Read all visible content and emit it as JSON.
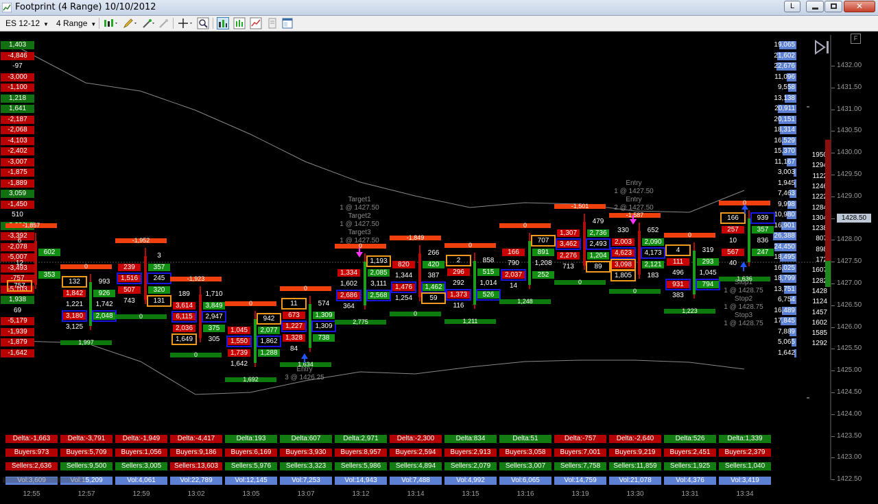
{
  "window": {
    "title": "Footprint (4 Range)  10/10/2012",
    "l_button": "L"
  },
  "toolbar": {
    "instrument": "ES 12-12",
    "period": "4 Range"
  },
  "colors": {
    "sell": "#c80000",
    "buy": "#138f13",
    "imbalance_blue": "#1818e0",
    "imbalance_orange": "#f19a1c",
    "volume": "#5b80d4",
    "delta_neg": "#f0400e",
    "delta_pos": "#0c7a0c"
  },
  "price_axis": {
    "labels": [
      "1432.00",
      "1431.50",
      "1431.00",
      "1430.50",
      "1430.00",
      "1429.50",
      "1429.00",
      "1428.50",
      "1428.00",
      "1427.50",
      "1427.00",
      "1426.50",
      "1426.00",
      "1425.50",
      "1425.00",
      "1424.50",
      "1424.00",
      "1423.50",
      "1423.00",
      "1422.50"
    ],
    "current_price": "1428.50"
  },
  "left_delta": [
    [
      "1,403",
      "g"
    ],
    [
      "-4,846",
      "r"
    ],
    [
      "-97",
      "k"
    ],
    [
      "-3,000",
      "r"
    ],
    [
      "-1,100",
      "r"
    ],
    [
      "1,218",
      "g"
    ],
    [
      "1,641",
      "g"
    ],
    [
      "-2,187",
      "r"
    ],
    [
      "-2,068",
      "r"
    ],
    [
      "-4,103",
      "r"
    ],
    [
      "-2,402",
      "r"
    ],
    [
      "-3,007",
      "r"
    ],
    [
      "-1,875",
      "r"
    ],
    [
      "-1,889",
      "r"
    ],
    [
      "3,059",
      "g"
    ],
    [
      "-1,450",
      "r"
    ],
    [
      "510",
      "k"
    ],
    [
      "2,281",
      "g"
    ],
    [
      "-3,392",
      "r"
    ],
    [
      "-2,078",
      "r"
    ],
    [
      "-5,007",
      "r"
    ],
    [
      "-3,493",
      "r"
    ],
    [
      "-757",
      "r"
    ],
    [
      "-5,103",
      "r"
    ],
    [
      "1,938",
      "g"
    ],
    [
      "69",
      "k"
    ],
    [
      "-5,179",
      "r"
    ],
    [
      "-1,939",
      "r"
    ],
    [
      "-1,879",
      "r"
    ],
    [
      "-1,642",
      "r"
    ]
  ],
  "volume_profile": [
    "19,065",
    "21,602",
    "22,676",
    "11,096",
    "9,558",
    "13,138",
    "20,911",
    "20,151",
    "18,314",
    "16,529",
    "15,370",
    "11,167",
    "3,003",
    "1,945",
    "7,463",
    "9,998",
    "10,980",
    "16,901",
    "26,388",
    "24,450",
    "18,495",
    "16,025",
    "18,799",
    "13,751",
    "6,754",
    "16,489",
    "17,845",
    "7,889",
    "5,065",
    "1,642"
  ],
  "pending_volumes": [
    "1950",
    "1294",
    "1122",
    "1246",
    "1222",
    "1284",
    "1304",
    "1238",
    "807",
    "898",
    "172",
    "1607",
    "1282",
    "1428",
    "1124",
    "1457",
    "1602",
    "1585",
    "1292"
  ],
  "bars": [
    {
      "time": "12:55",
      "delta": "Delta:-1,663",
      "buyers": "Buyers:973",
      "sellers": "Sellers:2,636",
      "vol": "Vol:3,609",
      "top": "-1,857",
      "bottom": "",
      "cells": [
        [
          "6",
          "",
          "",
          ""
        ],
        [
          "",
          "602",
          "",
          ""
        ],
        [
          "12",
          "",
          "",
          ""
        ],
        [
          "",
          "353",
          "",
          ""
        ],
        [
          "757",
          "",
          "o",
          ""
        ]
      ]
    },
    {
      "time": "12:57",
      "delta": "Delta:-3,791",
      "buyers": "Buyers:5,709",
      "sellers": "Sellers:9,500",
      "vol": "Vol:15,209",
      "top": "0",
      "bottom": "1,997",
      "cells": [
        [
          "132",
          "993",
          "o",
          ""
        ],
        [
          "1,842",
          "926",
          "",
          ""
        ],
        [
          "1,221",
          "1,742",
          "",
          ""
        ],
        [
          "3,180",
          "2,048",
          "b",
          "b"
        ],
        [
          "3,125",
          "",
          "",
          ""
        ]
      ]
    },
    {
      "time": "12:59",
      "delta": "Delta:-1,949",
      "buyers": "Buyers:1,056",
      "sellers": "Sellers:3,005",
      "vol": "Vol:4,061",
      "top": "-1,952",
      "bottom": "0",
      "cells": [
        [
          "",
          "3",
          "",
          ""
        ],
        [
          "239",
          "357",
          "",
          ""
        ],
        [
          "1,516",
          "245",
          "b",
          "b"
        ],
        [
          "507",
          "320",
          "",
          ""
        ],
        [
          "743",
          "131",
          "",
          "o"
        ]
      ]
    },
    {
      "time": "13:02",
      "delta": "Delta:-4,417",
      "buyers": "Buyers:9,186",
      "sellers": "Sellers:13,603",
      "vol": "Vol:22,789",
      "top": "-1,923",
      "bottom": "0",
      "cells": [
        [
          "189",
          "1,710",
          "",
          ""
        ],
        [
          "3,614",
          "3,849",
          "",
          ""
        ],
        [
          "6,115",
          "2,947",
          "b",
          "b"
        ],
        [
          "2,036",
          "375",
          "",
          ""
        ],
        [
          "1,649",
          "305",
          "o",
          ""
        ]
      ]
    },
    {
      "time": "13:05",
      "delta": "Delta:193",
      "buyers": "Buyers:6,169",
      "sellers": "Sellers:5,976",
      "vol": "Vol:12,145",
      "top": "0",
      "bottom": "1,692",
      "cells": [
        [
          "",
          "942",
          "",
          "o"
        ],
        [
          "1,045",
          "2,077",
          "",
          ""
        ],
        [
          "1,550",
          "1,862",
          "b",
          "b"
        ],
        [
          "1,739",
          "1,288",
          "",
          ""
        ],
        [
          "1,642",
          "",
          "",
          ""
        ]
      ]
    },
    {
      "time": "13:07",
      "delta": "Delta:607",
      "buyers": "Buyers:3,930",
      "sellers": "Sellers:3,323",
      "vol": "Vol:7,253",
      "top": "0",
      "bottom": "1,634",
      "cells": [
        [
          "11",
          "574",
          "o",
          ""
        ],
        [
          "673",
          "1,309",
          "",
          ""
        ],
        [
          "1,227",
          "1,309",
          "b",
          "b"
        ],
        [
          "1,328",
          "738",
          "",
          ""
        ],
        [
          "84",
          "",
          "",
          ""
        ]
      ]
    },
    {
      "time": "13:12",
      "delta": "Delta:2,971",
      "buyers": "Buyers:8,957",
      "sellers": "Sellers:5,986",
      "vol": "Vol:14,943",
      "top": "0",
      "bottom": "2,775",
      "cells": [
        [
          "",
          "1,193",
          "",
          "o"
        ],
        [
          "1,334",
          "2,085",
          "",
          ""
        ],
        [
          "1,602",
          "3,111",
          "",
          ""
        ],
        [
          "2,686",
          "2,568",
          "b",
          "b"
        ],
        [
          "364",
          "",
          "",
          ""
        ]
      ]
    },
    {
      "time": "13:14",
      "delta": "Delta:-2,300",
      "buyers": "Buyers:2,594",
      "sellers": "Sellers:4,894",
      "vol": "Vol:7,488",
      "top": "-1,849",
      "bottom": "0",
      "cells": [
        [
          "",
          "266",
          "",
          ""
        ],
        [
          "820",
          "420",
          "",
          ""
        ],
        [
          "1,344",
          "387",
          "",
          ""
        ],
        [
          "1,476",
          "1,462",
          "b",
          "b"
        ],
        [
          "1,254",
          "59",
          "",
          "o"
        ]
      ]
    },
    {
      "time": "13:15",
      "delta": "Delta:834",
      "buyers": "Buyers:2,913",
      "sellers": "Sellers:2,079",
      "vol": "Vol:4,992",
      "top": "0",
      "bottom": "1,211",
      "cells": [
        [
          "2",
          "858",
          "o",
          ""
        ],
        [
          "296",
          "515",
          "",
          ""
        ],
        [
          "292",
          "1,014",
          "",
          ""
        ],
        [
          "1,373",
          "526",
          "b",
          "b"
        ],
        [
          "116",
          "",
          "",
          ""
        ]
      ]
    },
    {
      "time": "13:16",
      "delta": "Delta:51",
      "buyers": "Buyers:3,058",
      "sellers": "Sellers:3,007",
      "vol": "Vol:6,065",
      "top": "0",
      "bottom": "1,248",
      "cells": [
        [
          "",
          "707",
          "",
          "o"
        ],
        [
          "166",
          "891",
          "",
          ""
        ],
        [
          "790",
          "1,208",
          "",
          ""
        ],
        [
          "2,037",
          "252",
          "b",
          ""
        ],
        [
          "14",
          "",
          "",
          ""
        ]
      ]
    },
    {
      "time": "13:19",
      "delta": "Delta:-757",
      "buyers": "Buyers:7,001",
      "sellers": "Sellers:7,758",
      "vol": "Vol:14,759",
      "top": "-1,501",
      "bottom": "0",
      "cells": [
        [
          "",
          "479",
          "",
          ""
        ],
        [
          "1,307",
          "2,736",
          "",
          ""
        ],
        [
          "3,462",
          "2,493",
          "b",
          "b"
        ],
        [
          "2,276",
          "1,204",
          "",
          ""
        ],
        [
          "713",
          "89",
          "",
          "o"
        ]
      ]
    },
    {
      "time": "13:30",
      "delta": "Delta:-2,640",
      "buyers": "Buyers:9,219",
      "sellers": "Sellers:11,859",
      "vol": "Vol:21,078",
      "top": "-1,587",
      "bottom": "0",
      "cells": [
        [
          "330",
          "652",
          "",
          ""
        ],
        [
          "2,003",
          "2,090",
          "",
          ""
        ],
        [
          "4,623",
          "4,173",
          "b",
          "b"
        ],
        [
          "3,098",
          "2,121",
          "o",
          ""
        ],
        [
          "1,805",
          "183",
          "o",
          ""
        ]
      ]
    },
    {
      "time": "13:31",
      "delta": "Delta:526",
      "buyers": "Buyers:2,451",
      "sellers": "Sellers:1,925",
      "vol": "Vol:4,376",
      "top": "0",
      "bottom": "1,223",
      "cells": [
        [
          "4",
          "319",
          "o",
          ""
        ],
        [
          "111",
          "293",
          "",
          ""
        ],
        [
          "496",
          "1,045",
          "",
          ""
        ],
        [
          "931",
          "794",
          "b",
          "b"
        ],
        [
          "383",
          "",
          "",
          ""
        ]
      ]
    },
    {
      "time": "13:34",
      "delta": "Delta:1,339",
      "buyers": "Buyers:2,379",
      "sellers": "Sellers:1,040",
      "vol": "Vol:3,419",
      "top": "0",
      "bottom": "1,636",
      "cells": [
        [
          "166",
          "939",
          "o",
          "b"
        ],
        [
          "257",
          "357",
          "",
          ""
        ],
        [
          "10",
          "836",
          "",
          ""
        ],
        [
          "567",
          "247",
          "",
          ""
        ],
        [
          "40",
          "",
          "",
          ""
        ]
      ]
    }
  ],
  "annotations": [
    {
      "lines": [
        "Target1",
        "1 @ 1427.50",
        "Target2",
        "1 @ 1427.50",
        "Target3",
        "1 @ 1427.50"
      ]
    },
    {
      "lines": [
        "Entry",
        "3 @ 1426.25"
      ]
    },
    {
      "lines": [
        "Entry",
        "1 @ 1427.50",
        "Entry",
        "2 @ 1427.50"
      ]
    },
    {
      "lines": [
        "Stop1",
        "1 @ 1428.75",
        "Stop2",
        "1 @ 1428.75",
        "Stop3",
        "1 @ 1428.75"
      ]
    }
  ]
}
